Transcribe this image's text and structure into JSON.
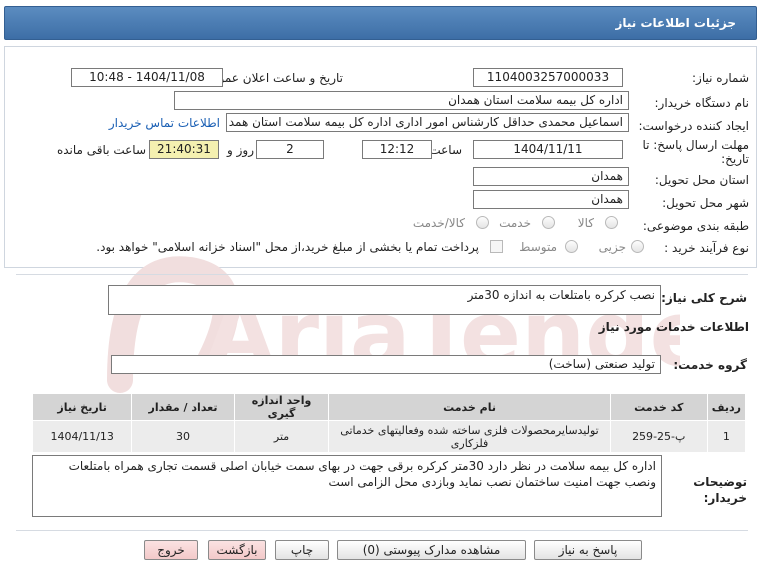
{
  "header": {
    "title": "جزئیات اطلاعات نیاز"
  },
  "fields": {
    "need_number_label": "شماره نیاز:",
    "need_number": "1104003257000033",
    "announce_label": "تاریخ و ساعت اعلان عمومی:",
    "announce_value": "1404/11/08 - 10:48",
    "buyer_org_label": "نام دستگاه خریدار:",
    "buyer_org": "اداره کل بیمه سلامت استان همدان",
    "creator_label": "ایجاد کننده درخواست:",
    "creator": "اسماعیل محمدی حداقل کارشناس امور اداری اداره کل بیمه سلامت استان همد",
    "contact_link": "اطلاعات تماس خریدار",
    "deadline_label": "مهلت ارسال پاسخ: تا تاریخ:",
    "deadline_date": "1404/11/11",
    "time_label": "ساعت",
    "deadline_time": "12:12",
    "days_value": "2",
    "days_label": "روز و",
    "remaining_time": "21:40:31",
    "remaining_label": "ساعت باقی مانده",
    "province_label": "استان محل تحویل:",
    "province": "همدان",
    "city_label": "شهر محل تحویل:",
    "city": "همدان",
    "category_label": "طبقه بندی موضوعی:",
    "category_options": [
      "کالا",
      "خدمت",
      "کالا/خدمت"
    ],
    "process_label": "نوع فرآیند خرید :",
    "process_options": [
      "جزیی",
      "متوسط"
    ],
    "payment_text": "پرداخت تمام یا بخشی از مبلغ خرید،از محل \"اسناد خزانه اسلامی\" خواهد بود."
  },
  "summary": {
    "label": "شرح کلی نیاز:",
    "value": "نصب کرکره بامتلعات به اندازه 30متر"
  },
  "services_heading": "اطلاعات خدمات مورد نیاز",
  "service_group": {
    "label": "گروه خدمت:",
    "value": "تولید صنعتی (ساخت)"
  },
  "table": {
    "headers": [
      "ردیف",
      "کد خدمت",
      "نام خدمت",
      "واحد اندازه گیری",
      "تعداد / مقدار",
      "تاریخ نیاز"
    ],
    "rows": [
      [
        "1",
        "پ-25-259",
        "تولیدسایرمحصولات فلزی ساخته شده وفعالیتهای خدماتی فلزکاری",
        "متر",
        "30",
        "1404/11/13"
      ]
    ]
  },
  "notes": {
    "label": "توضیحات خریدار:",
    "value": "اداره کل بیمه سلامت در نظر دارد 30متر کرکره برقی جهت در بهای سمت خیابان اصلی قسمت تجاری همراه بامتلعات ونصب جهت امنیت  ساختمان نصب نماید وبازدی محل الزامی است"
  },
  "buttons": {
    "reply": "پاسخ به نیاز",
    "view_docs": "مشاهده مدارک پیوستی (0)",
    "print": "چاپ",
    "back": "بازگشت",
    "exit": "خروج"
  },
  "watermark": "AriaTender.net",
  "colors": {
    "header_bg": "#3d6ea6",
    "link": "#1a5fb4",
    "time_bg": "#f4f0b0",
    "watermark": "#f2d9d9"
  }
}
